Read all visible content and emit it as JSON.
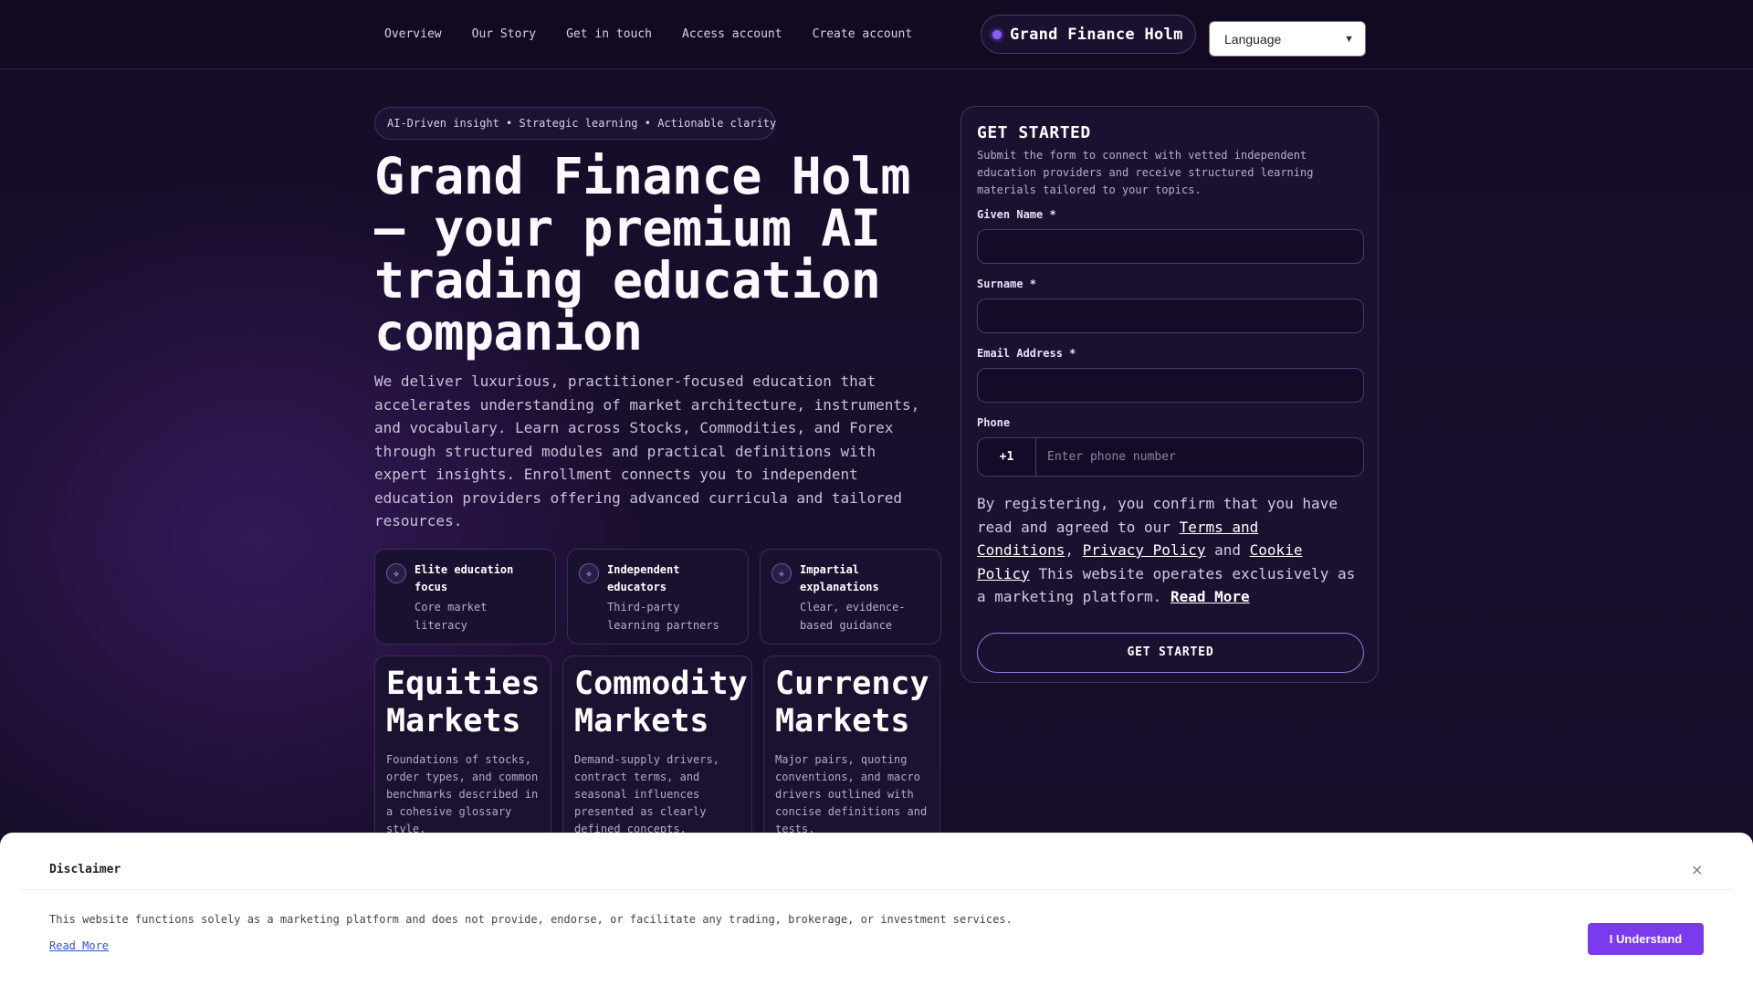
{
  "nav": {
    "items": [
      "Overview",
      "Our Story",
      "Get in touch",
      "Access account",
      "Create account"
    ]
  },
  "brand": {
    "name": "Grand Finance Holm"
  },
  "language": {
    "selected": "Language"
  },
  "hero": {
    "pill": "AI-Driven insight • Strategic learning • Actionable clarity",
    "title": "Grand Finance Holm — your premium AI trading education companion",
    "description": "We deliver luxurious, practitioner-focused education that accelerates understanding of market architecture, instruments, and vocabulary. Learn across Stocks, Commodities, and Forex through structured modules and practical definitions with expert insights. Enrollment connects you to independent education providers offering advanced curricula and tailored resources."
  },
  "features": [
    {
      "icon": "sparkle-icon",
      "title": "Elite education focus",
      "subtitle": "Core market literacy"
    },
    {
      "icon": "sparkle-icon",
      "title": "Independent educators",
      "subtitle": "Third-party learning partners"
    },
    {
      "icon": "sparkle-icon",
      "title": "Impartial explanations",
      "subtitle": "Clear, evidence-based guidance"
    }
  ],
  "markets": [
    {
      "title": "Equities Markets",
      "desc": "Foundations of stocks, order types, and common benchmarks described in a cohesive glossary style."
    },
    {
      "title": "Commodity Markets",
      "desc": "Demand-supply drivers, contract terms, and seasonal influences presented as clearly defined concepts."
    },
    {
      "title": "Currency Markets",
      "desc": "Major pairs, quoting conventions, and macro drivers outlined with concise definitions and tests."
    }
  ],
  "form": {
    "heading": "GET STARTED",
    "subtitle": "Submit the form to connect with vetted independent education providers and receive structured learning materials tailored to your topics.",
    "given_name_label": "Given Name *",
    "surname_label": "Surname *",
    "email_label": "Email Address *",
    "phone_label": "Phone",
    "phone_code": "+1",
    "phone_placeholder": "Enter phone number",
    "legal_prefix": "By registering, you confirm that you have read and agreed to our",
    "terms": "Terms and Conditions",
    "comma": ",",
    "privacy": "Privacy Policy",
    "and": "and",
    "cookie": "Cookie Policy",
    "legal_suffix": "This website operates exclusively as a marketing platform.",
    "read_more": "Read More",
    "submit": "GET STARTED"
  },
  "disclaimer": {
    "title": "Disclaimer",
    "close": "×",
    "text": "This website functions solely as a marketing platform and does not provide, endorse, or facilitate any trading, brokerage, or investment services.",
    "read_more": "Read More",
    "accept": "I Understand"
  },
  "colors": {
    "background": "#160c27",
    "accent": "#8b5cf6",
    "button_primary": "#7c3aed"
  }
}
